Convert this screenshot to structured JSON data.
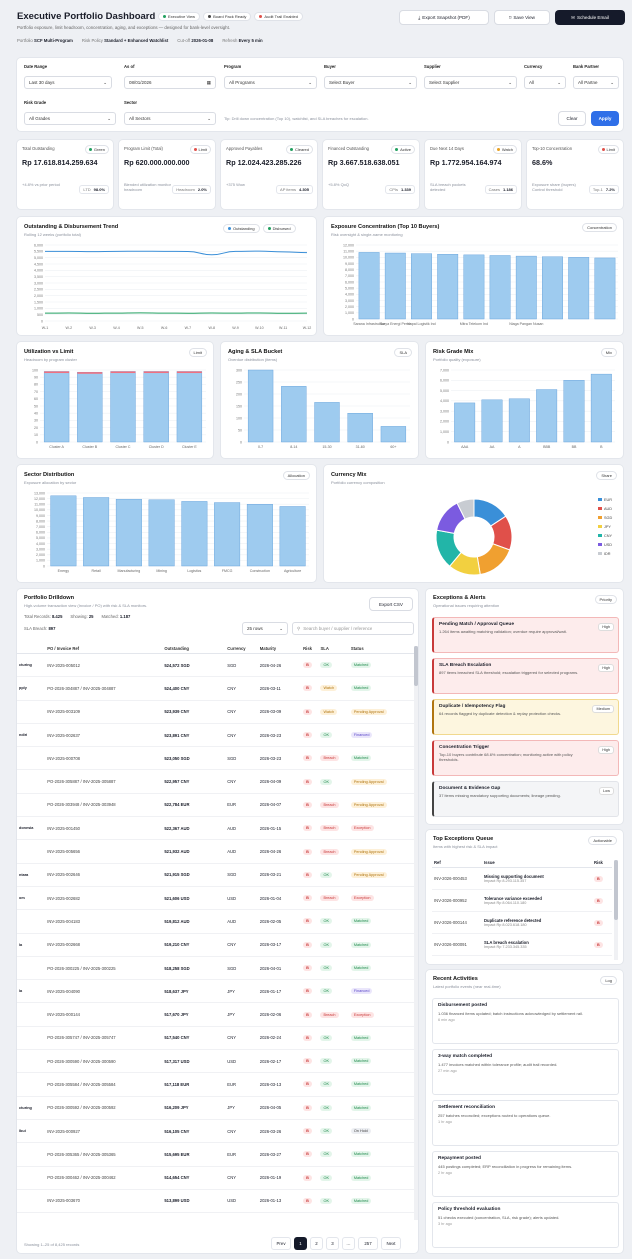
{
  "header": {
    "title": "Executive Portfolio Dashboard",
    "subtitle": "Portfolio exposure, limit headroom, concentration, aging, and exceptions — designed for bank-level oversight.",
    "tags": [
      "Executive View",
      "Board Pack Ready",
      "Audit Trail Enabled"
    ],
    "tag_colors": [
      "#22a060",
      "#444444",
      "#e0504a"
    ],
    "export_label": "Export Snapshot (PDF)",
    "save_label": "Save View",
    "schedule_label": "Schedule Email"
  },
  "meta": [
    {
      "k": "Portfolio",
      "v": "SCF Multi-Program"
    },
    {
      "k": "Risk Policy",
      "v": "Standard + Enhanced Watchlist"
    },
    {
      "k": "Cut-off",
      "v": "2026-01-08"
    },
    {
      "k": "Refresh",
      "v": "Every 5 min"
    }
  ],
  "filters": {
    "date_range": {
      "label": "Date Range",
      "value": "Last 30 days"
    },
    "as_of": {
      "label": "As of",
      "value": "08/01/2026"
    },
    "program": {
      "label": "Program",
      "value": "All Programs"
    },
    "buyer": {
      "label": "Buyer",
      "value": "Select Buyer"
    },
    "supplier": {
      "label": "Supplier",
      "value": "Select Supplier"
    },
    "currency": {
      "label": "Currency",
      "value": "All"
    },
    "bank_partner": {
      "label": "Bank Partner",
      "value": "All Partne"
    },
    "risk_grade": {
      "label": "Risk Grade",
      "value": "All Grades"
    },
    "sector": {
      "label": "Sector",
      "value": "All Sectors"
    },
    "tip": "Tip: Drill down concentration (Top 10), watchlist, and SLA breaches for escalation.",
    "clear": "Clear",
    "apply": "Apply"
  },
  "kpis": [
    {
      "title": "Total Outstanding",
      "badge": "Green",
      "badge_color": "#22a060",
      "value": "Rp 17.618.814.259.634",
      "sub": "+4.8% vs prior period",
      "mini_k": "LTD",
      "mini_v": "98.0%"
    },
    {
      "title": "Program Limit (Total)",
      "badge": "Limit",
      "badge_color": "#e0504a",
      "value": "Rp 620.000.000.000",
      "sub": "Blended utilization monitor headroom",
      "mini_k": "Headroom",
      "mini_v": "2.0%"
    },
    {
      "title": "Approved Payables",
      "badge": "Cleared",
      "badge_color": "#22a060",
      "value": "Rp 12.024.423.285.226",
      "sub": "+375 Wow",
      "mini_k": "AP items",
      "mini_v": "4.305"
    },
    {
      "title": "Financed Outstanding",
      "badge": "Active",
      "badge_color": "#22a060",
      "value": "Rp 3.667.518.638.051",
      "sub": "+5.8% QoQ",
      "mini_k": "CPIs",
      "mini_v": "1.339"
    },
    {
      "title": "Due Next 14 Days",
      "badge": "Watch",
      "badge_color": "#e8a020",
      "value": "Rp 1.772.954.164.974",
      "sub": "SLA breach pockets detected",
      "mini_k": "Cases",
      "mini_v": "1.186"
    },
    {
      "title": "Top-10 Concentration",
      "badge": "Limit",
      "badge_color": "#e0504a",
      "value": "68.6%",
      "sub": "Exposure share (buyers)",
      "mini_k": "Top-1",
      "mini_v": "7.2%",
      "sub2": "Control threshold"
    }
  ],
  "trend_card": {
    "title": "Outstanding & Disbursement Trend",
    "sub": "Rolling 12 weeks (portfolio total)",
    "legend": [
      "Outstanding",
      "Disbursed"
    ],
    "legend_colors": [
      "#3a8fd8",
      "#22a060"
    ]
  },
  "expo_card": {
    "title": "Exposure Concentration (Top 10 Buyers)",
    "sub": "Risk oversight & single-name monitoring",
    "chip": "Concentration"
  },
  "util_card": {
    "title": "Utilization vs Limit",
    "sub": "Headroom by program cluster",
    "chip": "Limit"
  },
  "aging_card": {
    "title": "Aging & SLA Bucket",
    "sub": "Overdue distribution (items)",
    "chip": "SLA"
  },
  "grade_card": {
    "title": "Risk Grade Mix",
    "sub": "Portfolio quality (exposure)",
    "chip": "Mix"
  },
  "sector_card": {
    "title": "Sector Distribution",
    "sub": "Exposure allocation by sector",
    "chip": "Allocation"
  },
  "ccy_card": {
    "title": "Currency Mix",
    "sub": "Portfolio currency composition",
    "chip": "Share"
  },
  "chart_data": [
    {
      "type": "line",
      "id": "trend",
      "x": [
        "W-1",
        "W-2",
        "W-3",
        "W-4",
        "W-5",
        "W-6",
        "W-7",
        "W-8",
        "W-9",
        "W-10",
        "W-11",
        "W-12"
      ],
      "ylim": [
        0,
        6000
      ],
      "yticks": [
        0,
        500,
        1000,
        1500,
        2000,
        2500,
        3000,
        3500,
        4000,
        4500,
        5000,
        5500,
        6000
      ],
      "series": [
        {
          "name": "Outstanding",
          "values": [
            5500,
            5500,
            5480,
            5500,
            5510,
            5500,
            5490,
            5230,
            5500,
            5520,
            5460,
            5400
          ],
          "color": "#3a8fd8"
        },
        {
          "name": "Disbursed",
          "values": [
            620,
            630,
            610,
            625,
            640,
            620,
            615,
            630,
            620,
            635,
            610,
            620
          ],
          "color": "#22a060"
        }
      ]
    },
    {
      "type": "bar",
      "id": "expo",
      "categories": [
        "Sarana Infrastruktur",
        "Surya Energi Perse",
        "Kapal Logistik Ind",
        "",
        "Mitra Telekom Ind",
        "",
        "Niaga Pangan Nusan",
        "",
        "",
        ""
      ],
      "values": [
        10800,
        10700,
        10600,
        10500,
        10400,
        10300,
        10200,
        10100,
        10000,
        9900
      ],
      "ylim": [
        0,
        12000
      ],
      "yticks": [
        0,
        1000,
        2000,
        3000,
        4000,
        5000,
        6000,
        7000,
        8000,
        9000,
        10000,
        11000,
        12000
      ]
    },
    {
      "type": "bar",
      "id": "util",
      "categories": [
        "Cluster A",
        "Cluster B",
        "Cluster C",
        "Cluster D",
        "Cluster E"
      ],
      "values": [
        98,
        97,
        98,
        98,
        98
      ],
      "ylim": [
        0,
        100
      ],
      "yticks": [
        0,
        10,
        20,
        30,
        40,
        50,
        60,
        70,
        80,
        90,
        100
      ]
    },
    {
      "type": "bar",
      "id": "aging",
      "categories": [
        "0-7",
        "8-14",
        "15-30",
        "31-60",
        "60+"
      ],
      "values": [
        300,
        232,
        165,
        120,
        65
      ],
      "ylim": [
        0,
        300
      ],
      "yticks": [
        0,
        50,
        100,
        150,
        200,
        250,
        300
      ]
    },
    {
      "type": "bar",
      "id": "grade",
      "categories": [
        "AAA",
        "AA",
        "A",
        "BBB",
        "BB",
        "B"
      ],
      "values": [
        3800,
        4100,
        4200,
        5100,
        6000,
        6600
      ],
      "ylim": [
        0,
        7000
      ],
      "yticks": [
        0,
        1000,
        2000,
        3000,
        4000,
        5000,
        6000,
        7000
      ]
    },
    {
      "type": "bar",
      "id": "sector",
      "categories": [
        "Energy",
        "Retail",
        "Manufacturing",
        "Mining",
        "Logistics",
        "FMCG",
        "Construction",
        "Agriculture"
      ],
      "values": [
        12500,
        12200,
        11900,
        11800,
        11500,
        11300,
        11000,
        10600
      ],
      "ylim": [
        0,
        13000
      ],
      "yticks": [
        0,
        1000,
        2000,
        3000,
        4000,
        5000,
        6000,
        7000,
        8000,
        9000,
        10000,
        11000,
        12000,
        13000
      ]
    },
    {
      "type": "pie",
      "id": "ccy",
      "categories": [
        "EUR",
        "AUD",
        "SGD",
        "JPY",
        "CNY",
        "USD",
        "IDR"
      ],
      "values": [
        15,
        14,
        16,
        13,
        16,
        14,
        7
      ],
      "colors": [
        "#3a8fd8",
        "#e0504a",
        "#f0a030",
        "#f2d040",
        "#22b5a8",
        "#7b5be0",
        "#c8ccd2"
      ]
    }
  ],
  "drill": {
    "title": "Portfolio Drilldown",
    "sub": "High-volume transaction view (Invoice / PO) with risk & SLA monitors.",
    "total_k": "Total Records:",
    "total_v": "8.425",
    "show_k": "Showing:",
    "show_v": "25",
    "match_k": "Matched:",
    "match_v": "1.187",
    "sla_k": "SLA Breach:",
    "sla_v": "897",
    "export": "Export CSV",
    "rows_sel": "25 rows",
    "search_ph": "Search buyer / supplier / reference",
    "cols": [
      "",
      "PO / Invoice Ref",
      "Outstanding",
      "Currency",
      "Maturity",
      "Risk",
      "SLA",
      "Status"
    ],
    "rows": [
      {
        "f": "cturing",
        "ref": "INV-2025-005012",
        "out": "524,572 SGD",
        "cc": "SGD",
        "mat": "2026-04-26",
        "risk": "B",
        "sla": "OK",
        "st": "Matched"
      },
      {
        "f": "pply",
        "ref": "PO-2026-304887 / INV-2025-304887",
        "out": "524,400 CNY",
        "cc": "CNY",
        "mat": "2026-03-11",
        "risk": "B",
        "sla": "Watch",
        "st": "Matched"
      },
      {
        "f": "",
        "ref": "INV-2025-003109",
        "out": "523,939 CNY",
        "cc": "CNY",
        "mat": "2026-03-09",
        "risk": "B",
        "sla": "Watch",
        "st": "Pending Approval"
      },
      {
        "f": "ndiri",
        "ref": "INV-2025-002637",
        "out": "523,891 CNY",
        "cc": "CNY",
        "mat": "2026-03-23",
        "risk": "B",
        "sla": "OK",
        "st": "Financed"
      },
      {
        "f": "",
        "ref": "INV-2025-000708",
        "out": "523,050 SGD",
        "cc": "SGD",
        "mat": "2026-03-23",
        "risk": "B",
        "sla": "Breach",
        "st": "Matched"
      },
      {
        "f": "",
        "ref": "PO-2026-305887 / INV-2025-305887",
        "out": "522,957 CNY",
        "cc": "CNY",
        "mat": "2026-04-09",
        "risk": "B",
        "sla": "OK",
        "st": "Pending Approval"
      },
      {
        "f": "",
        "ref": "PO-2026-303948 / INV-2025-303948",
        "out": "522,784 EUR",
        "cc": "EUR",
        "mat": "2026-04-07",
        "risk": "B",
        "sla": "Breach",
        "st": "Pending Approval"
      },
      {
        "f": "donesia",
        "ref": "INV-2025-001450",
        "out": "522,367 AUD",
        "cc": "AUD",
        "mat": "2026-01-15",
        "risk": "B",
        "sla": "Breach",
        "st": "Exception"
      },
      {
        "f": "",
        "ref": "INV-2025-005656",
        "out": "521,932 AUD",
        "cc": "AUD",
        "mat": "2026-04-26",
        "risk": "B",
        "sla": "Breach",
        "st": "Pending Approval"
      },
      {
        "f": "ntara",
        "ref": "INV-2025-002646",
        "out": "521,915 SGD",
        "cc": "SGD",
        "mat": "2026-03-21",
        "risk": "B",
        "sla": "OK",
        "st": "Pending Approval"
      },
      {
        "f": "om",
        "ref": "INV-2025-002682",
        "out": "521,606 USD",
        "cc": "USD",
        "mat": "2026-01-04",
        "risk": "B",
        "sla": "Breach",
        "st": "Exception"
      },
      {
        "f": "",
        "ref": "INV-2025-004183",
        "out": "519,812 AUD",
        "cc": "AUD",
        "mat": "2026-02-05",
        "risk": "B",
        "sla": "OK",
        "st": "Matched"
      },
      {
        "f": "la",
        "ref": "INV-2025-002668",
        "out": "519,210 CNY",
        "cc": "CNY",
        "mat": "2026-03-17",
        "risk": "B",
        "sla": "OK",
        "st": "Matched"
      },
      {
        "f": "",
        "ref": "PO-2026-300225 / INV-2025-300225",
        "out": "518,258 SGD",
        "cc": "SGD",
        "mat": "2026-04-01",
        "risk": "B",
        "sla": "OK",
        "st": "Matched"
      },
      {
        "f": "la",
        "ref": "INV-2025-004090",
        "out": "518,637 JPY",
        "cc": "JPY",
        "mat": "2026-01-17",
        "risk": "B",
        "sla": "OK",
        "st": "Financed"
      },
      {
        "f": "",
        "ref": "INV-2025-000144",
        "out": "517,670 JPY",
        "cc": "JPY",
        "mat": "2026-02-06",
        "risk": "B",
        "sla": "Breach",
        "st": "Exception"
      },
      {
        "f": "",
        "ref": "PO-2026-305747 / INV-2025-305747",
        "out": "517,540 CNY",
        "cc": "CNY",
        "mat": "2026-02-24",
        "risk": "B",
        "sla": "OK",
        "st": "Matched"
      },
      {
        "f": "",
        "ref": "PO-2026-300590 / INV-2025-300590",
        "out": "517,317 USD",
        "cc": "USD",
        "mat": "2026-02-17",
        "risk": "B",
        "sla": "OK",
        "st": "Matched"
      },
      {
        "f": "",
        "ref": "PO-2026-305584 / INV-2025-305584",
        "out": "517,118 EUR",
        "cc": "EUR",
        "mat": "2026-03-13",
        "risk": "B",
        "sla": "OK",
        "st": "Matched"
      },
      {
        "f": "cturing",
        "ref": "PO-2026-300592 / INV-2025-300592",
        "out": "516,209 JPY",
        "cc": "JPY",
        "mat": "2026-04-05",
        "risk": "B",
        "sla": "OK",
        "st": "Matched"
      },
      {
        "f": "lbui",
        "ref": "INV-2025-000927",
        "out": "516,105 CNY",
        "cc": "CNY",
        "mat": "2026-03-26",
        "risk": "B",
        "sla": "OK",
        "st": "On Hold"
      },
      {
        "f": "",
        "ref": "PO-2026-305365 / INV-2025-305365",
        "out": "515,695 EUR",
        "cc": "EUR",
        "mat": "2026-03-27",
        "risk": "B",
        "sla": "OK",
        "st": "Matched"
      },
      {
        "f": "",
        "ref": "PO-2026-300462 / INV-2025-300462",
        "out": "514,654 CNY",
        "cc": "CNY",
        "mat": "2026-01-19",
        "risk": "B",
        "sla": "OK",
        "st": "Matched"
      },
      {
        "f": "",
        "ref": "INV-2025-003670",
        "out": "513,899 USD",
        "cc": "USD",
        "mat": "2026-01-13",
        "risk": "B",
        "sla": "OK",
        "st": "Matched"
      }
    ],
    "showing": "Showing 1–25 of 8,425 records",
    "pages": [
      "Prev",
      "1",
      "2",
      "3",
      "…",
      "257",
      "Next"
    ]
  },
  "alerts": {
    "title": "Exceptions & Alerts",
    "sub": "Operational issues requiring attention",
    "chip": "Priority",
    "items": [
      {
        "t": "Pending Match / Approval Queue",
        "d": "1.264 items awaiting matching validation; overdue require approval/wait.",
        "b": "High",
        "kind": "red"
      },
      {
        "t": "SLA Breach Escalation",
        "d": "897 items breached SLA threshold; escalation triggered for selected programs.",
        "b": "High",
        "kind": "red"
      },
      {
        "t": "Duplicate / Idempotency Flag",
        "d": "64 records flagged by duplicate detection & replay protection checks.",
        "b": "Medium",
        "kind": "amber"
      },
      {
        "t": "Concentration Trigger",
        "d": "Top-10 buyers contribute 68.6% concentration; monitoring active with policy thresholds.",
        "b": "High",
        "kind": "red"
      },
      {
        "t": "Document & Evidence Gap",
        "d": "37 items missing mandatory supporting documents; lineage pending.",
        "b": "Low",
        "kind": "gray"
      }
    ]
  },
  "queue": {
    "title": "Top Exceptions Queue",
    "sub": "Items with highest risk & SLA impact",
    "chip": "Actionable",
    "cols": [
      "Ref",
      "Issue",
      "Risk"
    ],
    "rows": [
      {
        "ref": "INV-2026-000453",
        "issue": "Missing supporting document",
        "imp": "Impact Rp 8.293.115.357",
        "risk": "B"
      },
      {
        "ref": "INV-2026-000952",
        "issue": "Tolerance variance exceeded",
        "imp": "Impact Rp 8.064.110.180",
        "risk": "B"
      },
      {
        "ref": "INV-2026-000144",
        "issue": "Duplicate reference detected",
        "imp": "Impact Rp 8.023.618.180",
        "risk": "B"
      },
      {
        "ref": "INV-2026-000091",
        "issue": "SLA breach escalation",
        "imp": "Impact Rp 7.233.345.335",
        "risk": "B"
      }
    ]
  },
  "activity": {
    "title": "Recent Activities",
    "sub": "Latest portfolio events (near real-time)",
    "chip": "Log",
    "items": [
      {
        "t": "Disbursement posted",
        "d": "1.036 financed items updated; batch instructions acknowledged by settlement rail.",
        "time": "6 min ago"
      },
      {
        "t": "3-way match completed",
        "d": "1.477 invoices matched within tolerance profile; audit trail recorded.",
        "time": "27 min ago"
      },
      {
        "t": "Settlement reconciliation",
        "d": "257 batches reconciled; exceptions routed to operations queue.",
        "time": "1 hr ago"
      },
      {
        "t": "Repayment posted",
        "d": "445 postings completed; ERP reconciliation in progress for remaining items.",
        "time": "2 hr ago"
      },
      {
        "t": "Policy threshold evaluation",
        "d": "51 checks executed (concentration, SLA, risk grade); alerts updated.",
        "time": "3 hr ago"
      }
    ]
  }
}
